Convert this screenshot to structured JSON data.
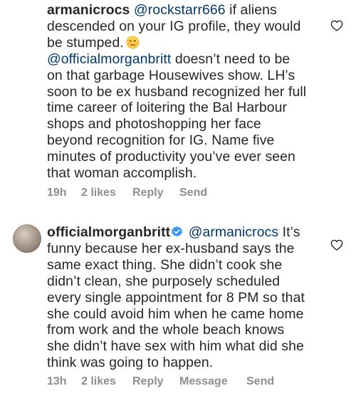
{
  "comments": [
    {
      "username": "armanicrocs",
      "lines": [
        [
          {
            "t": "armanicrocs",
            "k": "user"
          },
          {
            "t": " ",
            "k": "p"
          },
          {
            "t": "@rockstarr666",
            "k": "mention"
          },
          {
            "t": " if aliens",
            "k": "p"
          }
        ],
        [
          {
            "t": "descended on your IG profile, they would",
            "k": "p"
          }
        ],
        [
          {
            "t": "be stumped.",
            "k": "p"
          },
          {
            "t": "",
            "k": "emoji"
          }
        ],
        [
          {
            "t": "@officialmorganbritt",
            "k": "mention"
          },
          {
            "t": " doesn’t need to be",
            "k": "p"
          }
        ],
        [
          {
            "t": "on that garbage Housewives show. LH’s",
            "k": "p"
          }
        ],
        [
          {
            "t": "soon to be ex husband recognized her full",
            "k": "p"
          }
        ],
        [
          {
            "t": "time career of loitering the Bal Harbour",
            "k": "p"
          }
        ],
        [
          {
            "t": "shops and photoshopping her face",
            "k": "p"
          }
        ],
        [
          {
            "t": "beyond recognition for IG. Name five",
            "k": "p"
          }
        ],
        [
          {
            "t": "minutes of productivity you’ve ever seen",
            "k": "p"
          }
        ],
        [
          {
            "t": "that woman accomplish.",
            "k": "p"
          }
        ]
      ],
      "meta": {
        "time": "19h",
        "likes": "2 likes",
        "reply": "Reply",
        "send": "Send"
      },
      "emoji_name": "woozy-face-emoji"
    },
    {
      "username": "officialmorganbritt",
      "lines": [
        [
          {
            "t": "officialmorganbritt",
            "k": "user"
          },
          {
            "t": "",
            "k": "verified"
          },
          {
            "t": "@armanicrocs",
            "k": "mention"
          },
          {
            "t": " It’s",
            "k": "p"
          }
        ],
        [
          {
            "t": "funny because her ex-husband says the",
            "k": "p"
          }
        ],
        [
          {
            "t": "same exact thing. She didn’t cook she",
            "k": "p"
          }
        ],
        [
          {
            "t": "didn’t clean, she purposely scheduled",
            "k": "p"
          }
        ],
        [
          {
            "t": "every single appointment for 8 PM so that",
            "k": "p"
          }
        ],
        [
          {
            "t": "she could avoid him when he came home",
            "k": "p"
          }
        ],
        [
          {
            "t": "from work and the whole beach knows",
            "k": "p"
          }
        ],
        [
          {
            "t": "she didn’t have sex with him what did she",
            "k": "p"
          }
        ],
        [
          {
            "t": "think was going to happen.",
            "k": "p"
          }
        ]
      ],
      "meta": {
        "time": "13h",
        "likes": "2 likes",
        "reply": "Reply",
        "message": "Message",
        "send": "Send"
      }
    }
  ],
  "colors": {
    "text": "#262626",
    "mention": "#00376b",
    "meta": "#8e8e8e",
    "verified": "#3897f0"
  },
  "icons": {
    "like": "heart-outline-icon",
    "verified": "verified-badge-icon"
  }
}
